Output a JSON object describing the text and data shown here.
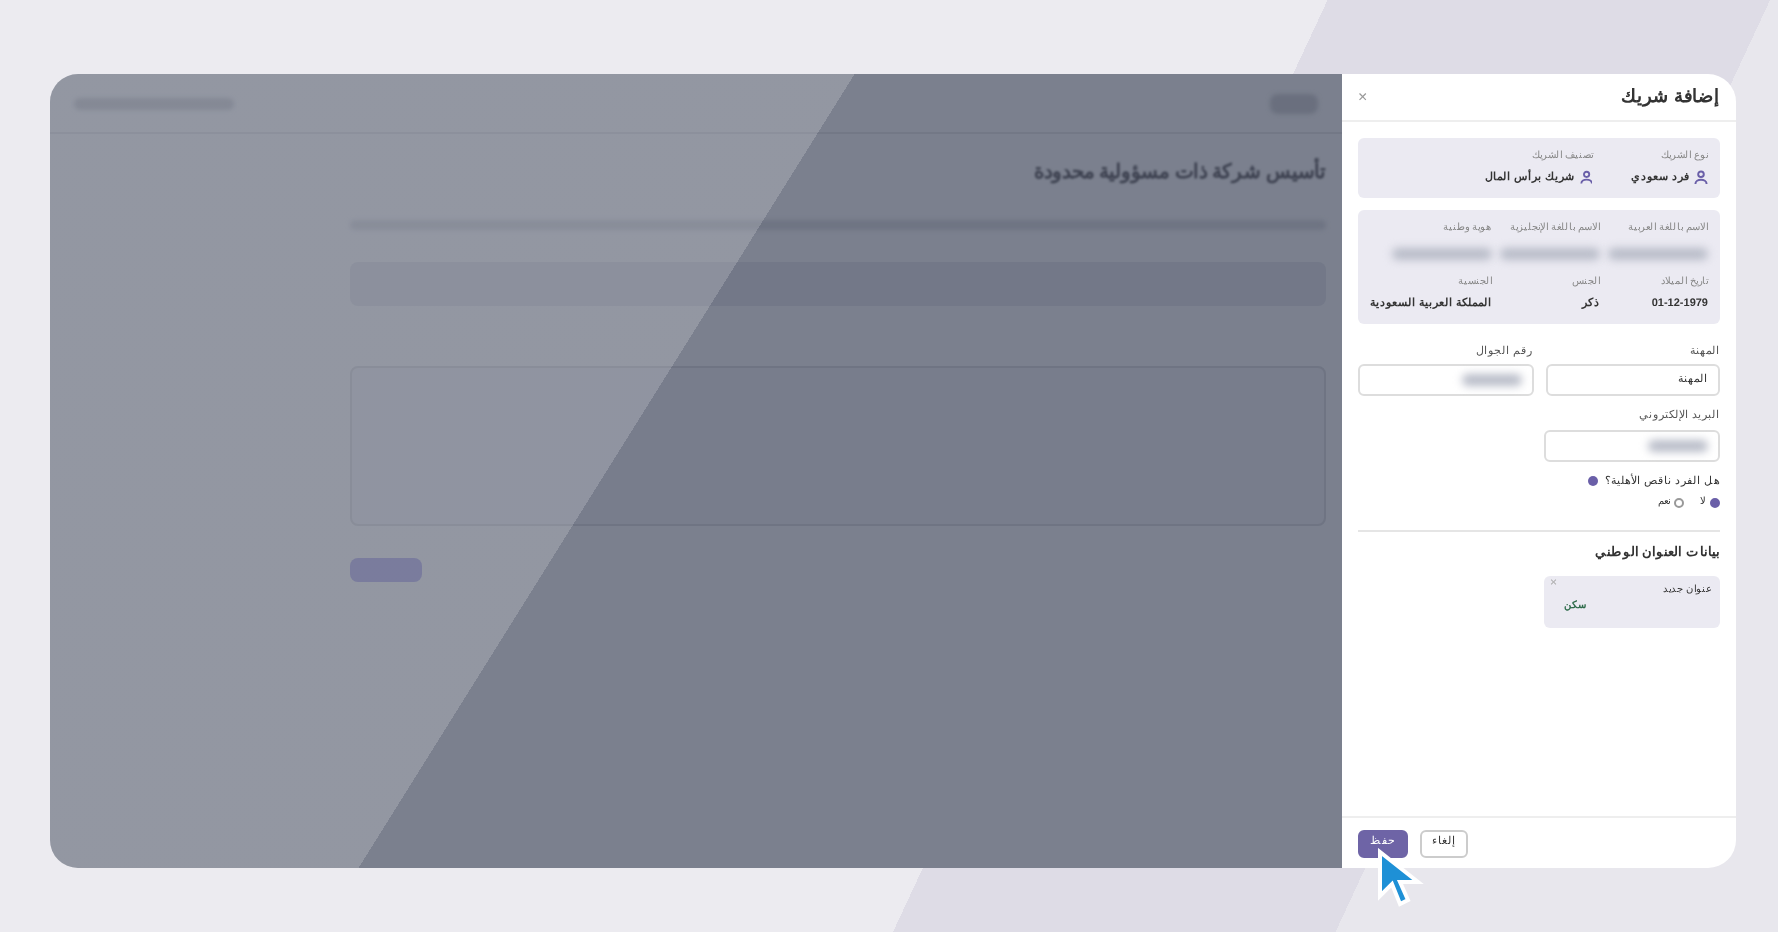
{
  "background_page": {
    "title": "تأسيس شركة ذات مسؤولية محدودة"
  },
  "drawer": {
    "title": "إضافة شريك",
    "close": "×",
    "partner_summary": [
      {
        "label": "نوع الشريك",
        "value": "فرد سعودي"
      },
      {
        "label": "تصنيف الشريك",
        "value": "شريك برأس المال"
      }
    ],
    "identity": [
      {
        "label": "الاسم باللغة العربية",
        "redacted": true
      },
      {
        "label": "الاسم باللغة الإنجليزية",
        "redacted": true
      },
      {
        "label": "هوية وطنية",
        "redacted": true
      },
      {
        "label": "تاريخ الميلاد",
        "value": "01-12-1979",
        "redacted": false
      },
      {
        "label": "الجنس",
        "value": "ذكر",
        "redacted": false
      },
      {
        "label": "الجنسية",
        "value": "المملكة العربية السعودية",
        "redacted": false
      }
    ],
    "fields": [
      {
        "label": "المهنة",
        "value": "المهنة",
        "redacted": false
      },
      {
        "label": "رقم الجوال",
        "redacted": true
      },
      {
        "label": "البريد الإلكتروني",
        "redacted": true
      }
    ],
    "question": {
      "label": "هل الفرد ناقص الأهلية؟",
      "options": [
        {
          "label": "لا",
          "selected": true
        },
        {
          "label": "نعم",
          "selected": false
        }
      ]
    },
    "address": {
      "heading": "بيانات العنوان الوطني",
      "card": {
        "title": "عنوان جديد",
        "tag": "سكن",
        "close": "×"
      }
    },
    "buttons": [
      {
        "label": "إلغاء",
        "kind": "secondary"
      },
      {
        "label": "حفظ",
        "kind": "primary"
      }
    ]
  }
}
